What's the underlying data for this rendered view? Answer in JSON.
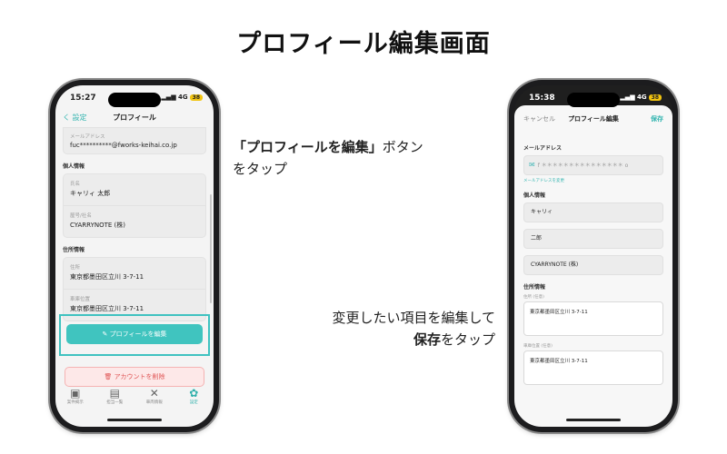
{
  "page": {
    "title": "プロフィール編集画面"
  },
  "left_phone": {
    "status": {
      "time": "15:27",
      "signal": "4G",
      "battery": "38"
    },
    "nav": {
      "back_label": "く 設定",
      "title": "プロフィール"
    },
    "email": {
      "label": "メールアドレス",
      "value": "fuc**********@fworks-keihai.co.jp"
    },
    "personal": {
      "heading": "個人情報",
      "name_label": "氏名",
      "name_value": "キャリィ 太郎",
      "company_label": "屋号/社名",
      "company_value": "CYARRYNOTE (株)"
    },
    "address": {
      "heading": "住所情報",
      "addr_label": "住所",
      "addr_value": "東京都墨田区立川 3-7-11",
      "location_label": "車庫位置",
      "location_value": "東京都墨田区立川 3-7-11"
    },
    "edit_button": "プロフィールを編集",
    "delete_button": "アカウントを削除",
    "tabs": [
      {
        "icon": "chat-icon",
        "glyph": "▣",
        "label": "案件掲示"
      },
      {
        "icon": "list-icon",
        "glyph": "▤",
        "label": "担当一覧"
      },
      {
        "icon": "tools-icon",
        "glyph": "✕",
        "label": "車両情報"
      },
      {
        "icon": "gear-icon",
        "glyph": "✿",
        "label": "設定"
      }
    ]
  },
  "instructions": {
    "step1_bold": "「プロフィールを編集」",
    "step1_tail": "ボタン",
    "step1_line2": "をタップ",
    "step2_line1": "変更したい項目を編集して",
    "step2_bold": "保存",
    "step2_tail": "をタップ"
  },
  "right_phone": {
    "status": {
      "time": "15:38",
      "signal": "4G",
      "battery": "38"
    },
    "nav": {
      "cancel_label": "キャンセル",
      "title": "プロフィール編集",
      "save_label": "保存"
    },
    "email": {
      "label": "メールアドレス",
      "value": "f ＊＊＊＊＊＊＊＊＊＊＊＊＊＊＊ o",
      "change_link": "メールアドレスを変更"
    },
    "personal": {
      "heading": "個人情報",
      "first_name": "キャリィ",
      "last_name": "二郎",
      "company": "CYARRYNOTE (株)"
    },
    "address": {
      "heading": "住所情報",
      "addr_label": "住所 (任意)",
      "addr_value": "東京都墨田区立川 3-7-11",
      "location_label": "車庫位置 (任意)",
      "location_value": "東京都墨田区立川 3-7-11"
    }
  }
}
